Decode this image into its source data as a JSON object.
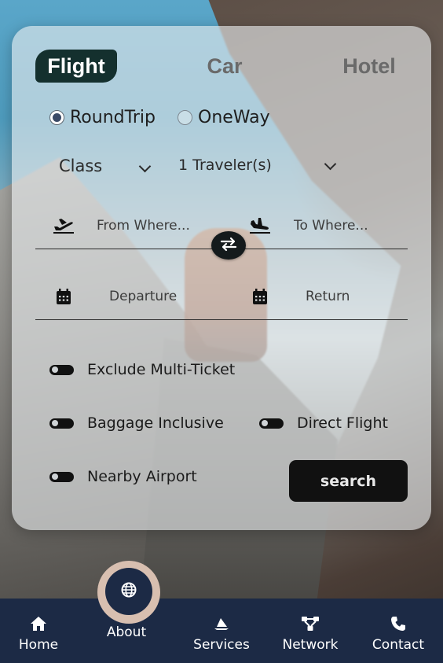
{
  "tabs": {
    "flight": "Flight",
    "car": "Car",
    "hotel": "Hotel",
    "active": "Flight"
  },
  "trip_type": {
    "round_trip": "RoundTrip",
    "one_way": "OneWay",
    "selected": "RoundTrip"
  },
  "selects": {
    "class": "Class",
    "travelers": "1 Traveler(s)"
  },
  "places": {
    "from_placeholder": "From Where...",
    "to_placeholder": "To Where..."
  },
  "dates": {
    "departure_placeholder": "Departure",
    "return_placeholder": "Return"
  },
  "options": {
    "exclude_multi_ticket": "Exclude Multi-Ticket",
    "baggage_inclusive": "Baggage Inclusive",
    "direct_flight": "Direct Flight",
    "nearby_airport": "Nearby Airport"
  },
  "search_label": "search",
  "nav": {
    "home": "Home",
    "about": "About",
    "services": "Services",
    "network": "Network",
    "contact": "Contact"
  },
  "icons": {
    "takeoff": "plane-departure-icon",
    "landing": "plane-arrival-icon",
    "swap": "swap-arrows-icon",
    "calendar": "calendar-icon",
    "home": "home-icon",
    "globe": "globe-icon",
    "services": "sail-icon",
    "network": "network-icon",
    "contact": "phone-icon"
  },
  "colors": {
    "active_tab_bg": "#14302e",
    "nav_bg": "#1c2a45",
    "button_bg": "#111111",
    "about_ring": "#d8bfb0"
  }
}
